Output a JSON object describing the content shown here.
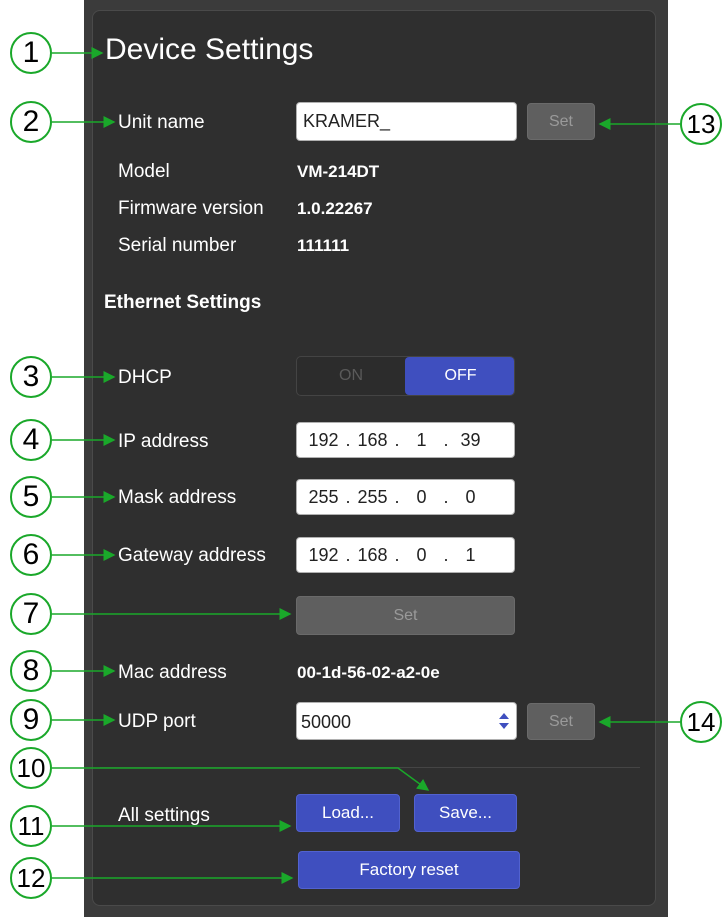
{
  "title": "Device Settings",
  "device": {
    "unit_name_label": "Unit name",
    "unit_name_value": "KRAMER_",
    "set_label": "Set",
    "model_label": "Model",
    "model_value": "VM-214DT",
    "firmware_label": "Firmware version",
    "firmware_value": "1.0.22267",
    "serial_label": "Serial number",
    "serial_value": "111111"
  },
  "ethernet": {
    "heading": "Ethernet Settings",
    "dhcp_label": "DHCP",
    "dhcp_on": "ON",
    "dhcp_off": "OFF",
    "dhcp_state": "OFF",
    "ip_label": "IP address",
    "ip": [
      "192",
      "168",
      "1",
      "39"
    ],
    "mask_label": "Mask address",
    "mask": [
      "255",
      "255",
      "0",
      "0"
    ],
    "gateway_label": "Gateway address",
    "gateway": [
      "192",
      "168",
      "0",
      "1"
    ],
    "set_label": "Set",
    "mac_label": "Mac address",
    "mac_value": "00-1d-56-02-a2-0e",
    "udp_label": "UDP port",
    "udp_value": "50000",
    "udp_set_label": "Set"
  },
  "all_settings": {
    "label": "All settings",
    "load_label": "Load...",
    "save_label": "Save...",
    "factory_reset_label": "Factory reset"
  },
  "callouts": [
    "1",
    "2",
    "3",
    "4",
    "5",
    "6",
    "7",
    "8",
    "9",
    "10",
    "11",
    "12",
    "13",
    "14"
  ],
  "colors": {
    "accent": "#3f4fbf",
    "panel": "#2f2f2f",
    "callout_line": "#1aa82a"
  }
}
